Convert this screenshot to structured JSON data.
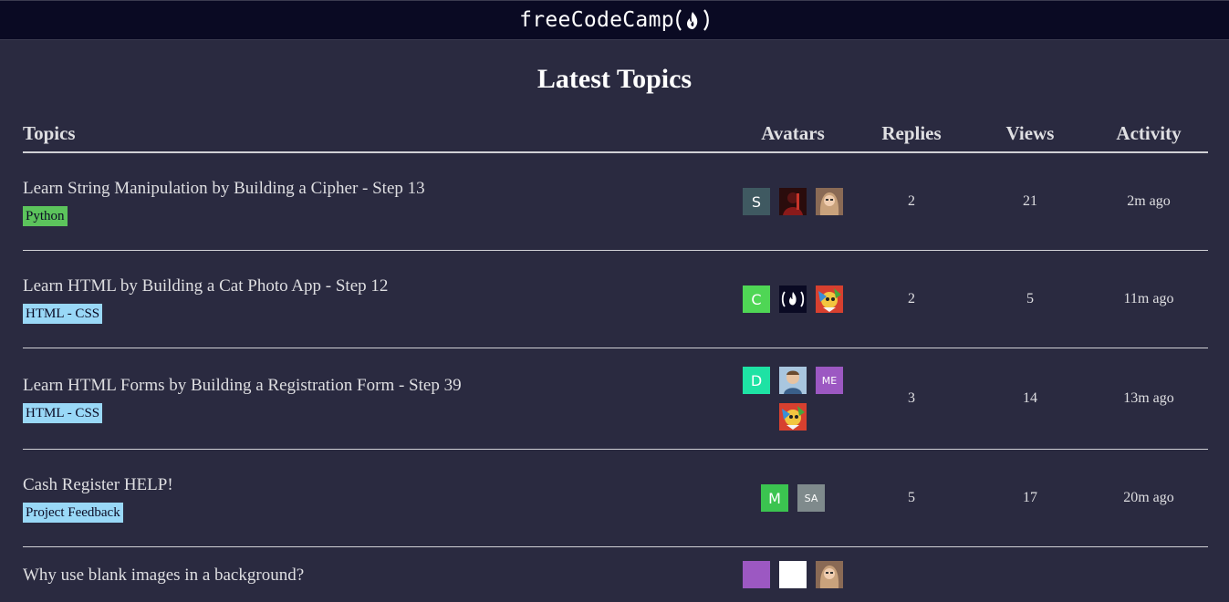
{
  "nav": {
    "brand": "freeCodeCamp"
  },
  "page": {
    "title": "Latest Topics"
  },
  "table": {
    "headers": {
      "topics": "Topics",
      "avatars": "Avatars",
      "replies": "Replies",
      "views": "Views",
      "activity": "Activity"
    },
    "rows": [
      {
        "title": "Learn String Manipulation by Building a Cipher - Step 13",
        "tag": "Python",
        "tag_color": "#5cc45c",
        "replies": "2",
        "views": "21",
        "activity": "2m ago",
        "avatars": [
          {
            "type": "letter",
            "text": "S",
            "color": "#3f5961"
          },
          {
            "type": "photo",
            "name": "user-photo-red"
          },
          {
            "type": "photo",
            "name": "user-photo-woman"
          }
        ]
      },
      {
        "title": "Learn HTML by Building a Cat Photo App - Step 12",
        "tag": "HTML - CSS",
        "tag_color": "#99d8f7",
        "replies": "2",
        "views": "5",
        "activity": "11m ago",
        "avatars": [
          {
            "type": "letter",
            "text": "C",
            "color": "#4fd655"
          },
          {
            "type": "logo",
            "name": "freecodecamp-logo"
          },
          {
            "type": "photo",
            "name": "user-photo-colorful"
          }
        ]
      },
      {
        "title": "Learn HTML Forms by Building a Registration Form - Step 39",
        "tag": "HTML - CSS",
        "tag_color": "#99d8f7",
        "replies": "3",
        "views": "14",
        "activity": "13m ago",
        "avatars": [
          {
            "type": "letter",
            "text": "D",
            "color": "#1ee2a4"
          },
          {
            "type": "photo",
            "name": "user-photo-man"
          },
          {
            "type": "letter",
            "text": "ME",
            "color": "#9c58c2",
            "small": true
          },
          {
            "type": "photo",
            "name": "user-photo-colorful"
          }
        ]
      },
      {
        "title": "Cash Register HELP!",
        "tag": "Project Feedback",
        "tag_color": "#99d8f7",
        "replies": "5",
        "views": "17",
        "activity": "20m ago",
        "avatars": [
          {
            "type": "letter",
            "text": "M",
            "color": "#3bc450"
          },
          {
            "type": "letter",
            "text": "SA",
            "color": "#7f8a8c",
            "small": true
          }
        ]
      },
      {
        "title": "Why use blank images in a background?",
        "tag": "",
        "tag_color": "#99d8f7",
        "replies": "",
        "views": "",
        "activity": "",
        "avatars": [
          {
            "type": "letter",
            "text": "",
            "color": "#9c58c2"
          },
          {
            "type": "letter",
            "text": "",
            "color": "#ffffff"
          },
          {
            "type": "photo",
            "name": "user-photo-woman"
          }
        ]
      }
    ]
  }
}
